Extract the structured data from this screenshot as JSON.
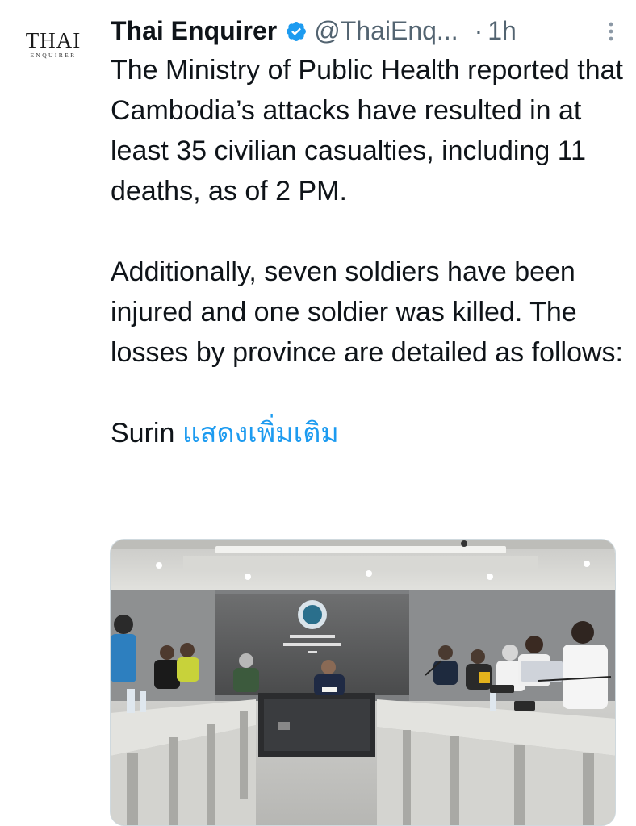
{
  "avatar": {
    "main_text": "THAI",
    "sub_text": "ENQUIRER"
  },
  "tweet": {
    "display_name": "Thai Enquirer",
    "handle": "@ThaiEnq...",
    "separator": "·",
    "time": "1h",
    "paragraphs": [
      "The Ministry of Public Health reported that Cambodia’s attacks have resulted in at least 35 civilian casualties, including 11 deaths, as of 2 PM.",
      "Additionally, seven soldiers have been injured and one soldier was killed. The losses by province are detailed as follows:",
      "Surin"
    ],
    "show_more": "แสดงเพิ่มเติม"
  },
  "colors": {
    "verified_badge": "#1d9bf0",
    "link": "#1d9bf0",
    "secondary_text": "#536471"
  },
  "icons": [
    "verified-badge-icon",
    "more-options-icon"
  ]
}
